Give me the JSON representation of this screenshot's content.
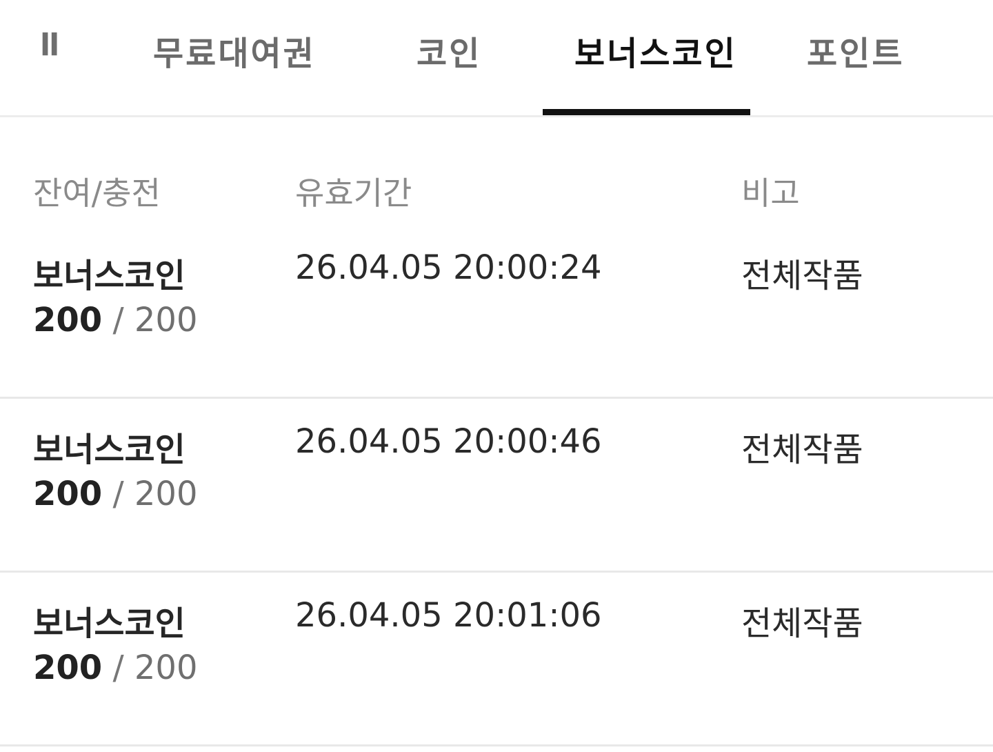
{
  "tabs": {
    "truncated_label": "ll",
    "items": [
      {
        "label": "무료대여권",
        "active": false
      },
      {
        "label": "코인",
        "active": false
      },
      {
        "label": "보너스코인",
        "active": true
      },
      {
        "label": "포인트",
        "active": false
      }
    ]
  },
  "table": {
    "headers": [
      "잔여/충전",
      "유효기간",
      "비고"
    ],
    "rows": [
      {
        "name": "보너스코인",
        "remaining": "200",
        "separator": " / ",
        "charged": "200",
        "expires": "26.04.05 20:00:24",
        "note": "전체작품"
      },
      {
        "name": "보너스코인",
        "remaining": "200",
        "separator": " / ",
        "charged": "200",
        "expires": "26.04.05 20:00:46",
        "note": "전체작품"
      },
      {
        "name": "보너스코인",
        "remaining": "200",
        "separator": " / ",
        "charged": "200",
        "expires": "26.04.05 20:01:06",
        "note": "전체작품"
      }
    ]
  },
  "colors": {
    "active_tab": "#111111",
    "inactive_tab": "#6b6b6b",
    "header_text": "#8a8a8a",
    "divider": "#e8e8e8"
  }
}
